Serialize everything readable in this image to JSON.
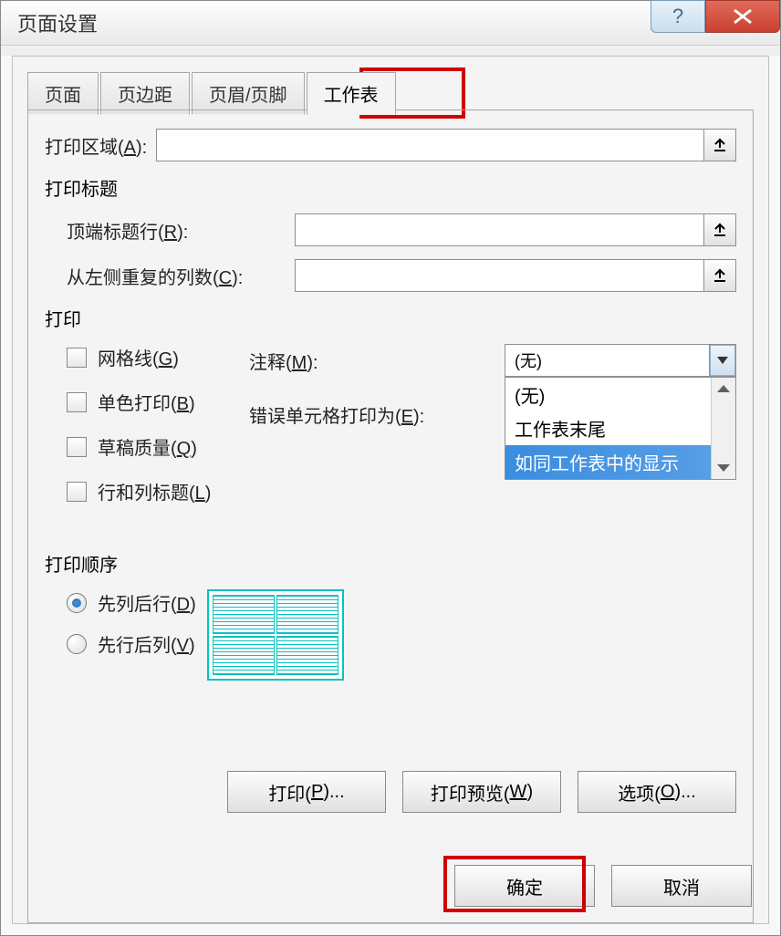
{
  "title": "页面设置",
  "tabs": [
    "页面",
    "页边距",
    "页眉/页脚",
    "工作表"
  ],
  "active_tab_index": 3,
  "print_area": {
    "label": "打印区域(",
    "hotkey": "A",
    "suffix": "):",
    "value": ""
  },
  "print_titles_header": "打印标题",
  "top_row": {
    "label": "顶端标题行(",
    "hotkey": "R",
    "suffix": "):",
    "value": ""
  },
  "left_col": {
    "label": "从左侧重复的列数(",
    "hotkey": "C",
    "suffix": "):",
    "value": ""
  },
  "print_header": "打印",
  "checks": {
    "grid": {
      "label": "网格线(",
      "hotkey": "G",
      "suffix": ")"
    },
    "mono": {
      "label": "单色打印(",
      "hotkey": "B",
      "suffix": ")"
    },
    "draft": {
      "label": "草稿质量(",
      "hotkey": "Q",
      "suffix": ")"
    },
    "rchead": {
      "label": "行和列标题(",
      "hotkey": "L",
      "suffix": ")"
    }
  },
  "comments": {
    "label": "注释(",
    "hotkey": "M",
    "suffix": "):",
    "value": "(无)",
    "options": [
      "(无)",
      "工作表末尾",
      "如同工作表中的显示"
    ],
    "selected_index": 2
  },
  "errors": {
    "label": "错误单元格打印为(",
    "hotkey": "E",
    "suffix": "):"
  },
  "order_header": "打印顺序",
  "order": {
    "down_over": {
      "label": "先列后行(",
      "hotkey": "D",
      "suffix": ")"
    },
    "over_down": {
      "label": "先行后列(",
      "hotkey": "V",
      "suffix": ")"
    },
    "selected": "down_over"
  },
  "buttons": {
    "print": {
      "label": "打印(",
      "hotkey": "P",
      "suffix": ")..."
    },
    "preview": {
      "label": "打印预览(",
      "hotkey": "W",
      "suffix": ")"
    },
    "options": {
      "label": "选项(",
      "hotkey": "O",
      "suffix": ")..."
    },
    "ok": "确定",
    "cancel": "取消"
  }
}
